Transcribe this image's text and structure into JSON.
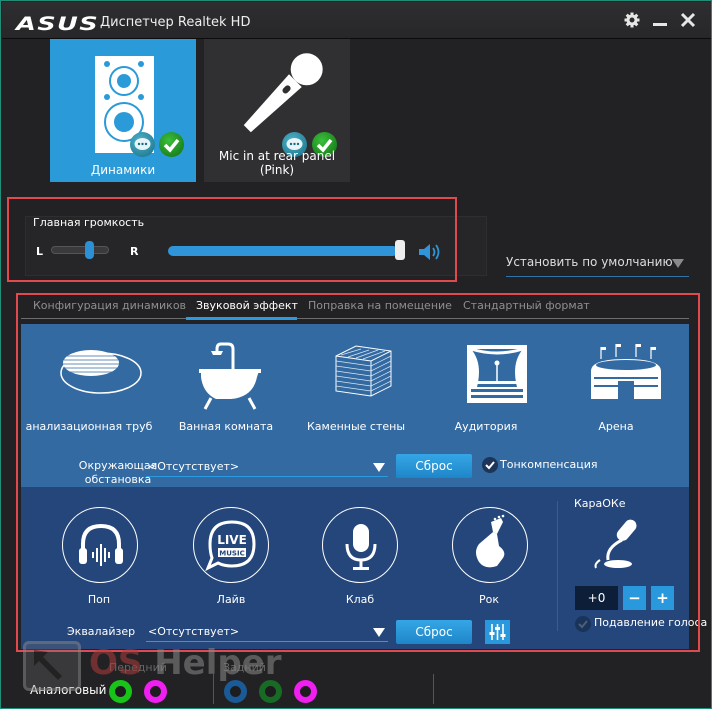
{
  "titlebar": {
    "logo": "ASUS",
    "title": "Диспетчер Realtek HD",
    "icons": [
      "gear-icon",
      "minimize-icon",
      "close-icon"
    ]
  },
  "devices": [
    {
      "label": "Динамики",
      "icon": "speaker-icon",
      "active": true
    },
    {
      "label": "Mic in at rear panel (Pink)",
      "icon": "microphone-icon",
      "active": false
    }
  ],
  "volume": {
    "title": "Главная громкость",
    "left_label": "L",
    "right_label": "R",
    "balance": 0.5,
    "level": 1.0
  },
  "set_default": {
    "label": "Установить по умолчанию"
  },
  "tabs": [
    {
      "label": "Конфигурация динамиков",
      "active": false
    },
    {
      "label": "Звуковой эффект",
      "active": true
    },
    {
      "label": "Поправка на помещение",
      "active": false
    },
    {
      "label": "Стандартный формат",
      "active": false
    }
  ],
  "environments": [
    {
      "label": "Канализационная труба",
      "visible_label": "анализационная труб",
      "icon": "manhole-icon"
    },
    {
      "label": "Ванная комната",
      "icon": "bathtub-icon"
    },
    {
      "label": "Каменные стены",
      "icon": "brick-wall-icon"
    },
    {
      "label": "Аудитория",
      "icon": "auditorium-icon"
    },
    {
      "label": "Арена",
      "icon": "arena-icon"
    }
  ],
  "environment_field": {
    "label_line1": "Окружающая",
    "label_line2": "обстановка",
    "value": "<Отсутствует>",
    "reset_label": "Сброс",
    "loudness_label": "Тонкомпенсация",
    "loudness_checked": true
  },
  "equalizer_presets": [
    {
      "label": "Поп",
      "icon": "headphones-icon"
    },
    {
      "label": "Лайв",
      "icon": "live-music-icon"
    },
    {
      "label": "Клаб",
      "icon": "club-mic-icon"
    },
    {
      "label": "Рок",
      "icon": "guitar-icon"
    }
  ],
  "live_icon_text": {
    "top": "LIVE",
    "bottom": "MUSIC"
  },
  "equalizer_field": {
    "label": "Эквалайзер",
    "value": "<Отсутствует>",
    "reset_label": "Сброс"
  },
  "karaoke": {
    "title": "КараОКе",
    "value": "+0",
    "minus": "−",
    "plus": "+",
    "voice_cancel_label": "Подавление голоса",
    "voice_cancel_checked": false
  },
  "jacks": {
    "front_label": "Передний",
    "rear_label": "Задний",
    "analog_label": "Аналоговый",
    "front": [
      {
        "color": "#18c418"
      },
      {
        "color": "#f01ef0"
      }
    ],
    "rear": [
      {
        "color": "#1a5a96"
      },
      {
        "color": "#176b24"
      },
      {
        "color": "#f01ef0"
      }
    ]
  },
  "watermark": {
    "part1": "OS",
    "part2": " Helper"
  }
}
